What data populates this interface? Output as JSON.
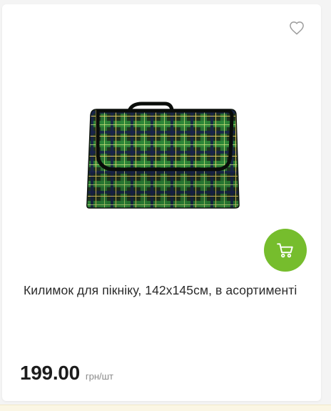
{
  "product": {
    "title": "Килимок для пікніку, 142х145см, в асортименті",
    "price": "199.00",
    "unit": "грн/шт",
    "image_icon": "plaid-picnic-blanket-image"
  },
  "actions": {
    "favorite_icon": "heart-outline-icon",
    "cart_icon": "shopping-cart-icon"
  },
  "colors": {
    "accent": "#76bd2d",
    "text": "#2a2a2a",
    "muted": "#8a8a8a"
  }
}
